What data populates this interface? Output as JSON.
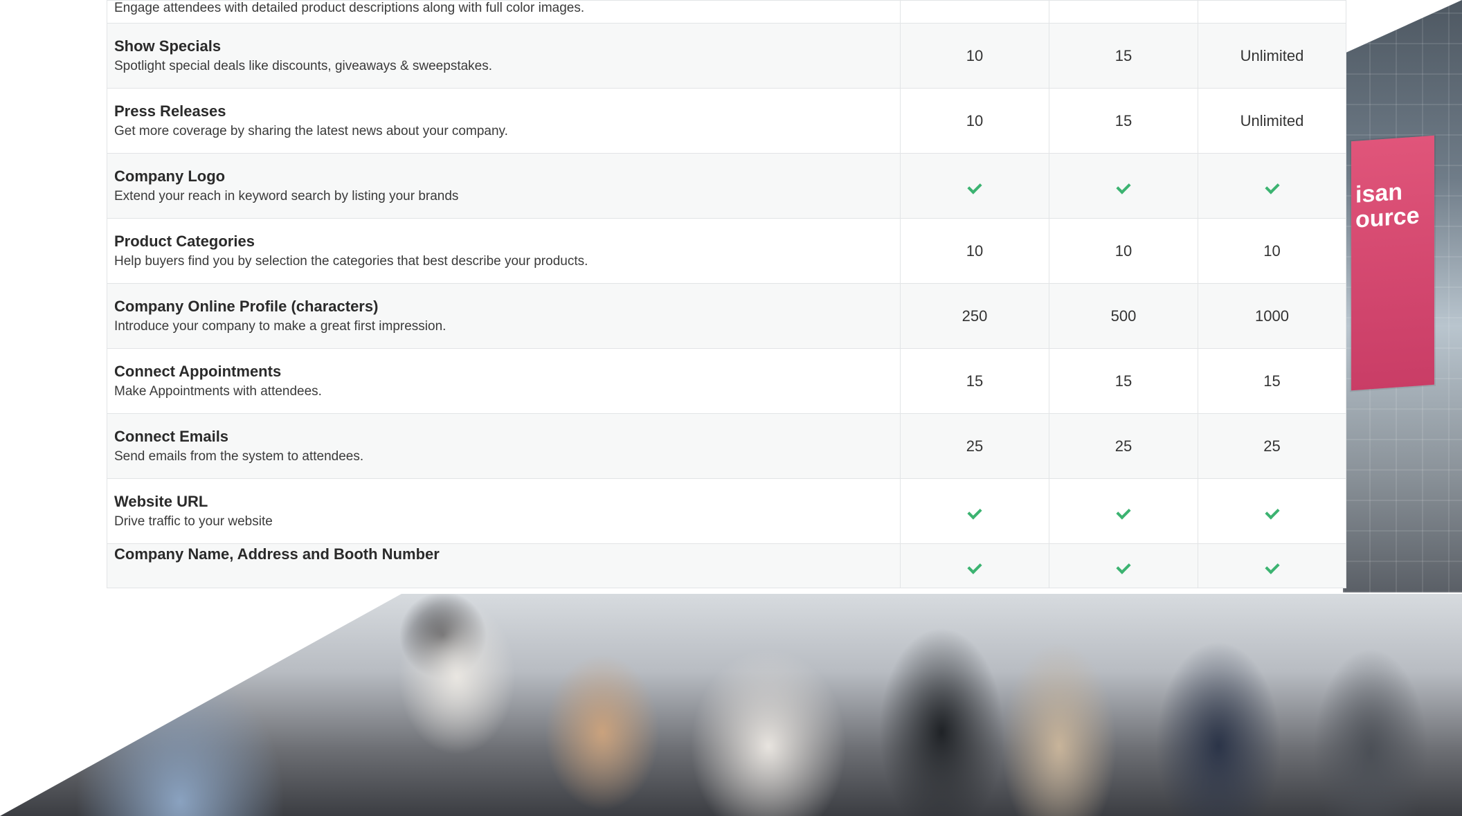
{
  "colors": {
    "check": "#3cb371",
    "border": "#e2e4e6",
    "banner": "#d94a70"
  },
  "banner": {
    "text": "isan\nource"
  },
  "top_row": {
    "desc": "Engage attendees with detailed product descriptions along with full color images."
  },
  "rows": [
    {
      "title": "Show Specials",
      "desc": "Spotlight special deals like discounts, giveaways & sweepstakes.",
      "values": [
        "10",
        "15",
        "Unlimited"
      ]
    },
    {
      "title": "Press Releases",
      "desc": "Get more coverage by sharing the latest news about your company.",
      "values": [
        "10",
        "15",
        "Unlimited"
      ]
    },
    {
      "title": "Company Logo",
      "desc": "Extend your reach in keyword search by listing your brands",
      "values": [
        "check-icon",
        "check-icon",
        "check-icon"
      ]
    },
    {
      "title": "Product Categories",
      "desc": "Help buyers find you by selection the categories that best describe your products.",
      "values": [
        "10",
        "10",
        "10"
      ]
    },
    {
      "title": "Company Online Profile (characters)",
      "desc": "Introduce your company to make a great first impression.",
      "values": [
        "250",
        "500",
        "1000"
      ]
    },
    {
      "title": "Connect Appointments",
      "desc": "Make Appointments with attendees.",
      "values": [
        "15",
        "15",
        "15"
      ]
    },
    {
      "title": "Connect Emails",
      "desc": "Send emails from the system to attendees.",
      "values": [
        "25",
        "25",
        "25"
      ]
    },
    {
      "title": "Website URL",
      "desc": "Drive traffic to your website",
      "values": [
        "check-icon",
        "check-icon",
        "check-icon"
      ]
    },
    {
      "title": "Company Name, Address and Booth Number",
      "desc": "",
      "values": [
        "check-icon",
        "check-icon",
        "check-icon"
      ]
    }
  ]
}
